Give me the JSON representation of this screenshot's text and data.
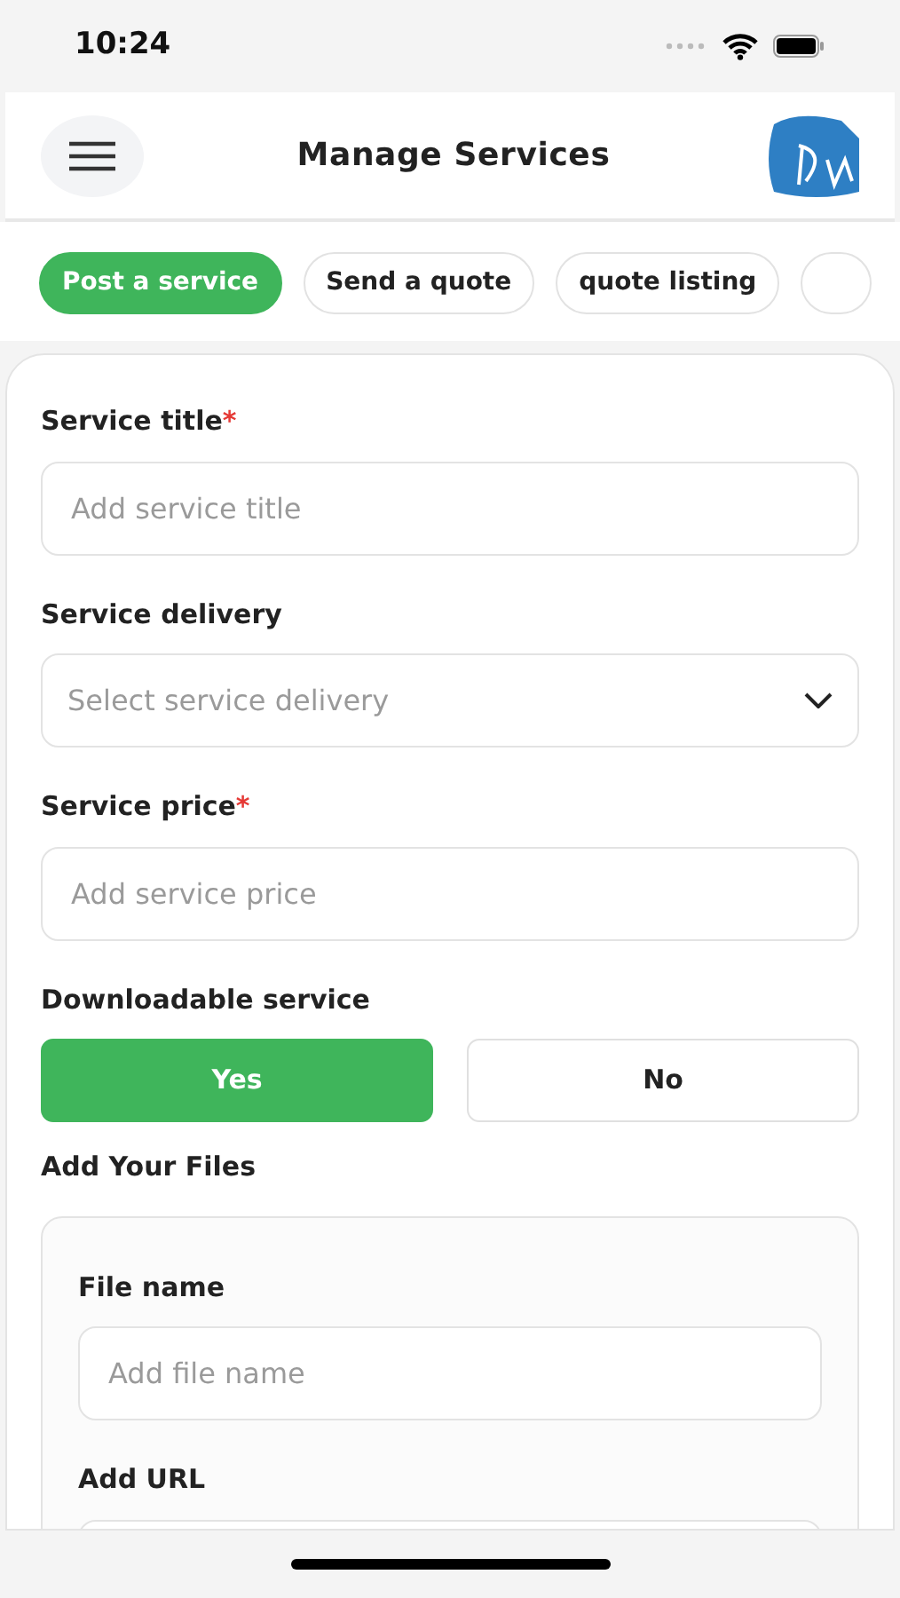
{
  "status_bar": {
    "time": "10:24"
  },
  "header": {
    "title": "Manage Services"
  },
  "tabs": [
    {
      "label": "Post a service",
      "selected": true
    },
    {
      "label": "Send a quote",
      "selected": false
    },
    {
      "label": "quote listing",
      "selected": false
    },
    {
      "selected": false
    }
  ],
  "form": {
    "fields": [
      {
        "kind": "text",
        "label": "Service title",
        "required_mark": "*",
        "placeholder": "Add service title"
      },
      {
        "kind": "select",
        "label": "Service delivery",
        "placeholder": "Select service delivery"
      },
      {
        "kind": "text",
        "label": "Service price",
        "required_mark": "*",
        "placeholder": "Add service price"
      }
    ],
    "downloadable": {
      "label": "Downloadable service",
      "options": [
        {
          "label": "Yes",
          "selected": true
        },
        {
          "label": "No",
          "selected": false
        }
      ]
    },
    "files": {
      "label": "Add Your Files",
      "fields": [
        {
          "label": "File name",
          "placeholder": "Add file name"
        },
        {
          "label": "Add URL"
        }
      ]
    }
  }
}
